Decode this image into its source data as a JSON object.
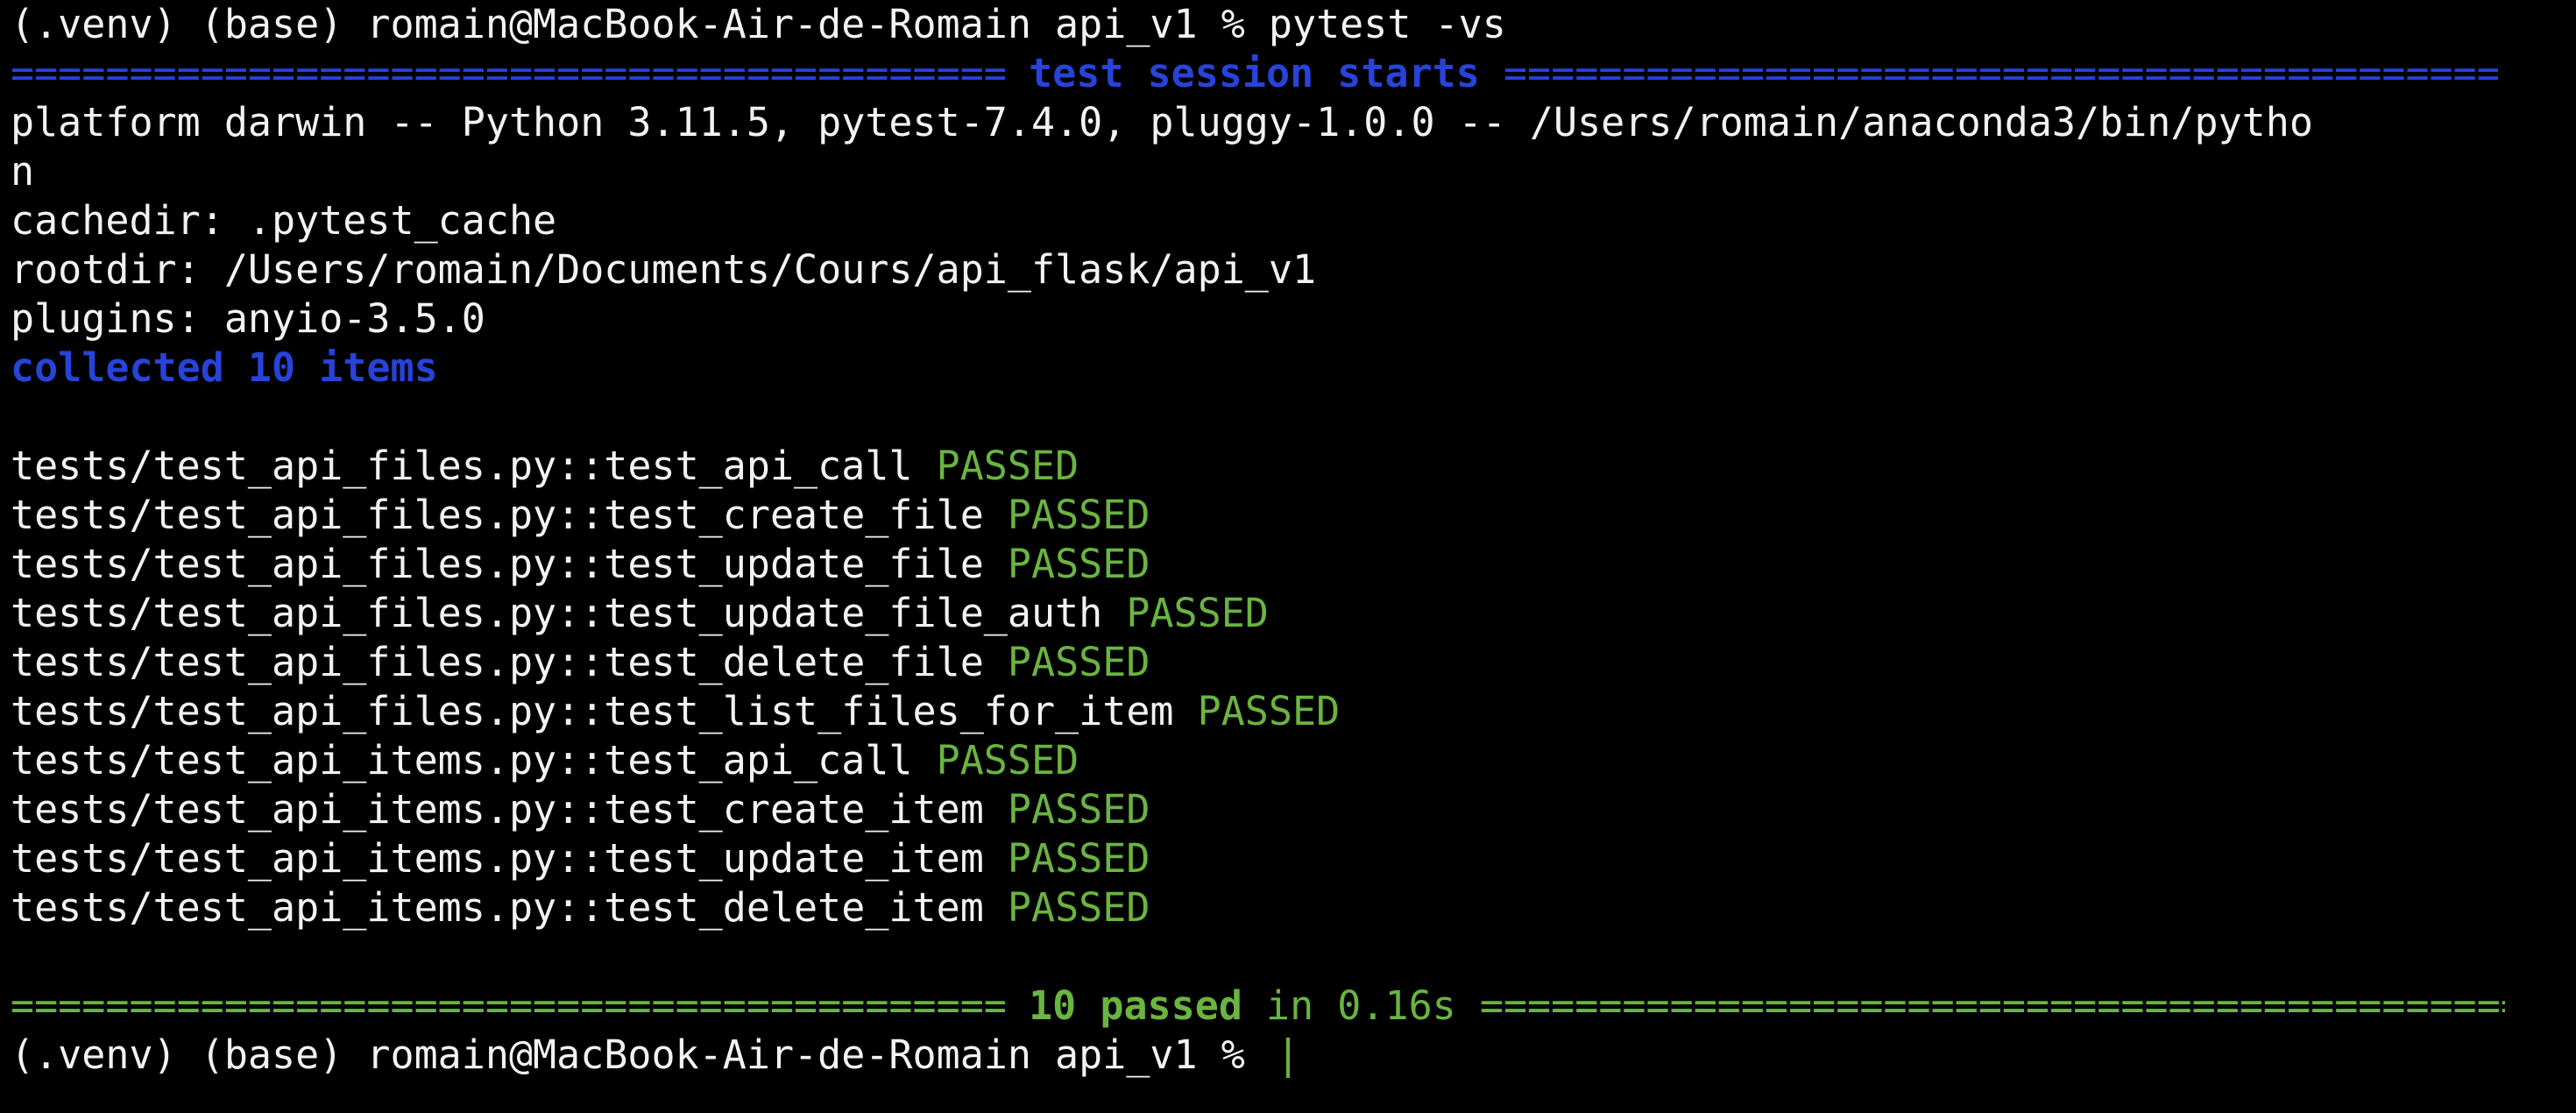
{
  "prompt_first": "(.venv) (base) romain@MacBook-Air-de-Romain api_v1 % ",
  "command": "pytest -vs",
  "header": {
    "title": "test session starts",
    "rule": "======================================================================"
  },
  "platform_line_1": "platform darwin -- Python 3.11.5, pytest-7.4.0, pluggy-1.0.0 -- /Users/romain/anaconda3/bin/pytho",
  "platform_line_2": "n",
  "cachedir": "cachedir: .pytest_cache",
  "rootdir": "rootdir: /Users/romain/Documents/Cours/api_flask/api_v1",
  "plugins": "plugins: anyio-3.5.0",
  "collected": "collected 10 items",
  "tests": [
    {
      "name": "tests/test_api_files.py::test_api_call",
      "status": "PASSED"
    },
    {
      "name": "tests/test_api_files.py::test_create_file",
      "status": "PASSED"
    },
    {
      "name": "tests/test_api_files.py::test_update_file",
      "status": "PASSED"
    },
    {
      "name": "tests/test_api_files.py::test_update_file_auth",
      "status": "PASSED"
    },
    {
      "name": "tests/test_api_files.py::test_delete_file",
      "status": "PASSED"
    },
    {
      "name": "tests/test_api_files.py::test_list_files_for_item",
      "status": "PASSED"
    },
    {
      "name": "tests/test_api_items.py::test_api_call",
      "status": "PASSED"
    },
    {
      "name": "tests/test_api_items.py::test_create_item",
      "status": "PASSED"
    },
    {
      "name": "tests/test_api_items.py::test_update_item",
      "status": "PASSED"
    },
    {
      "name": "tests/test_api_items.py::test_delete_item",
      "status": "PASSED"
    }
  ],
  "summary": {
    "passed": "10 passed",
    "timing": "in 0.16s"
  },
  "prompt_last": "(.venv) (base) romain@MacBook-Air-de-Romain api_v1 % ",
  "colors": {
    "background": "#000000",
    "text": "#f2f2f2",
    "blue": "#2743d9",
    "green": "#6ab440"
  }
}
